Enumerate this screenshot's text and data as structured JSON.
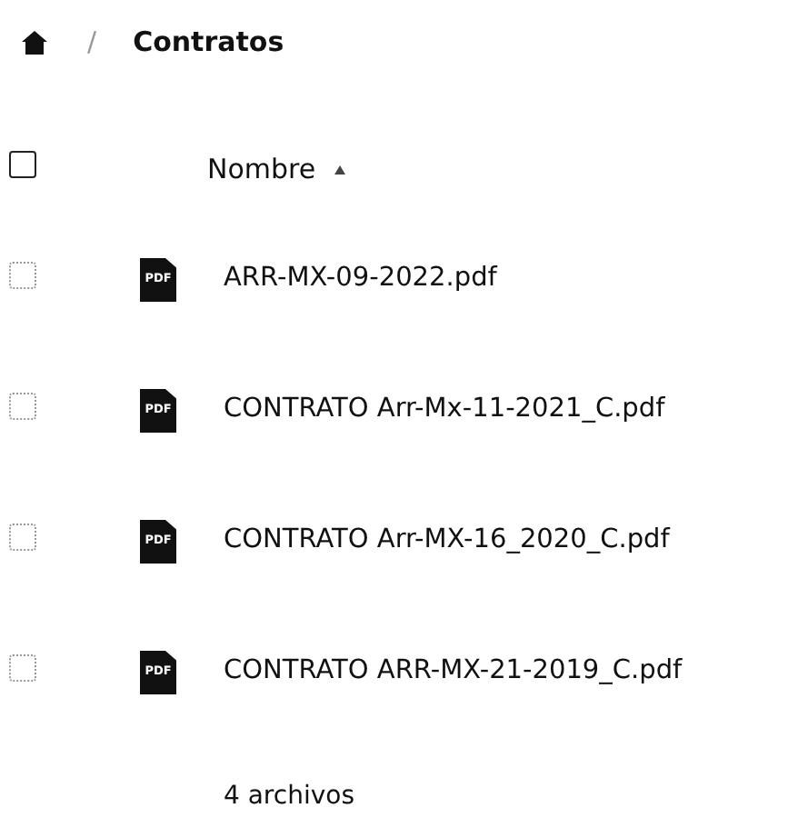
{
  "breadcrumb": {
    "separator": "/",
    "current": "Contratos"
  },
  "header": {
    "select_all_checked": false,
    "column": "Nombre",
    "sort_ascending": true
  },
  "files": [
    {
      "name": "ARR-MX-09-2022.pdf",
      "icon_label": "PDF",
      "checked": false
    },
    {
      "name": "CONTRATO Arr-Mx-11-2021_C.pdf",
      "icon_label": "PDF",
      "checked": false
    },
    {
      "name": "CONTRATO Arr-MX-16_2020_C.pdf",
      "icon_label": "PDF",
      "checked": false
    },
    {
      "name": "CONTRATO ARR-MX-21-2019_C.pdf",
      "icon_label": "PDF",
      "checked": false
    }
  ],
  "footer": "4 archivos"
}
